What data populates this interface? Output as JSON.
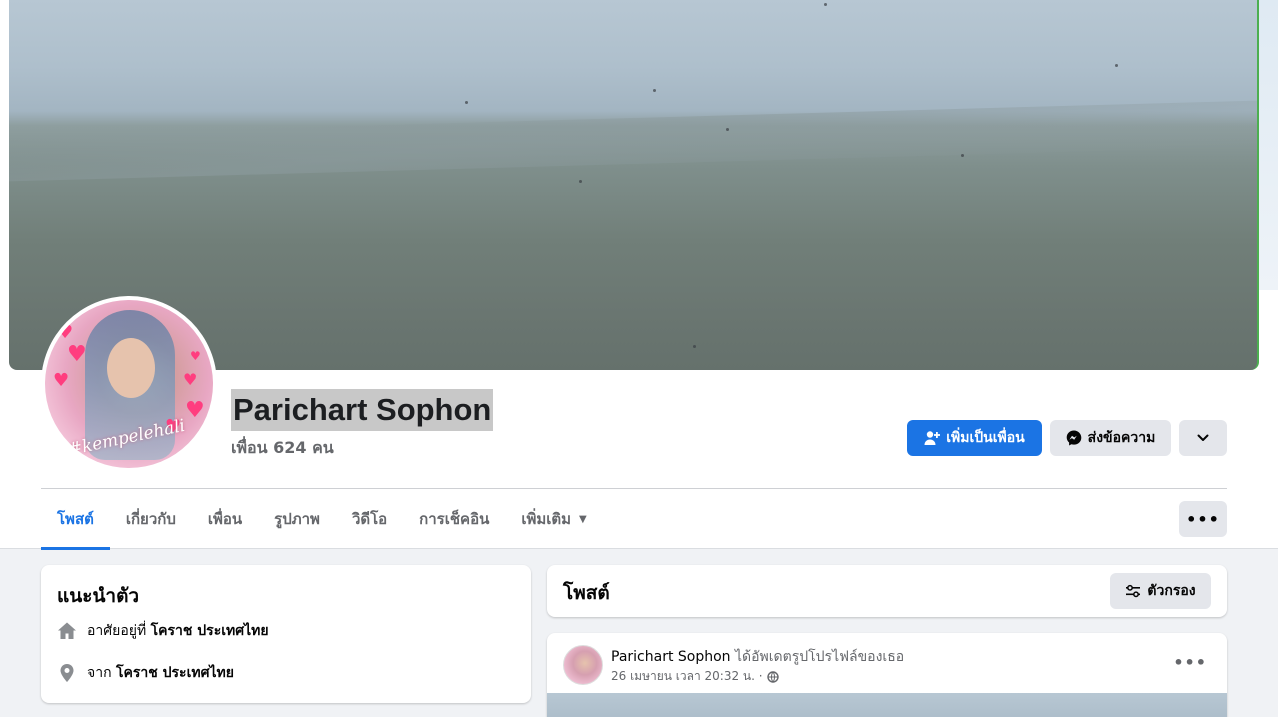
{
  "profile": {
    "name": "Parichart Sophon",
    "friends": "เพื่อน 624 คน",
    "avatar_caption": "#kempelehali"
  },
  "actions": {
    "add_friend": "เพิ่มเป็นเพื่อน",
    "message": "ส่งข้อความ"
  },
  "tabs": [
    {
      "label": "โพสต์",
      "active": true
    },
    {
      "label": "เกี่ยวกับ"
    },
    {
      "label": "เพื่อน"
    },
    {
      "label": "รูปภาพ"
    },
    {
      "label": "วิดีโอ"
    },
    {
      "label": "การเช็คอิน"
    },
    {
      "label": "เพิ่มเติม"
    }
  ],
  "intro": {
    "title": "แนะนำตัว",
    "lives_prefix": "อาศัยอยู่ที่",
    "lives_value": "โคราช ประเทศไทย",
    "from_prefix": "จาก",
    "from_value": "โคราช ประเทศไทย"
  },
  "posts": {
    "title": "โพสต์",
    "filter_label": "ตัวกรอง"
  },
  "post": {
    "author": "Parichart Sophon",
    "action": "ได้อัพเดตรูปโปรไฟล์ของเธอ",
    "time": "26 เมษายน เวลา 20:32 น. ·"
  },
  "colors": {
    "accent": "#1b74e4",
    "secondary_button": "#e4e6eb",
    "page_background": "#f0f2f5"
  },
  "icons": [
    "add-friend-icon",
    "messenger-icon",
    "chevron-down-icon",
    "more-icon",
    "home-icon",
    "location-pin-icon",
    "filter-icon",
    "globe-icon"
  ]
}
